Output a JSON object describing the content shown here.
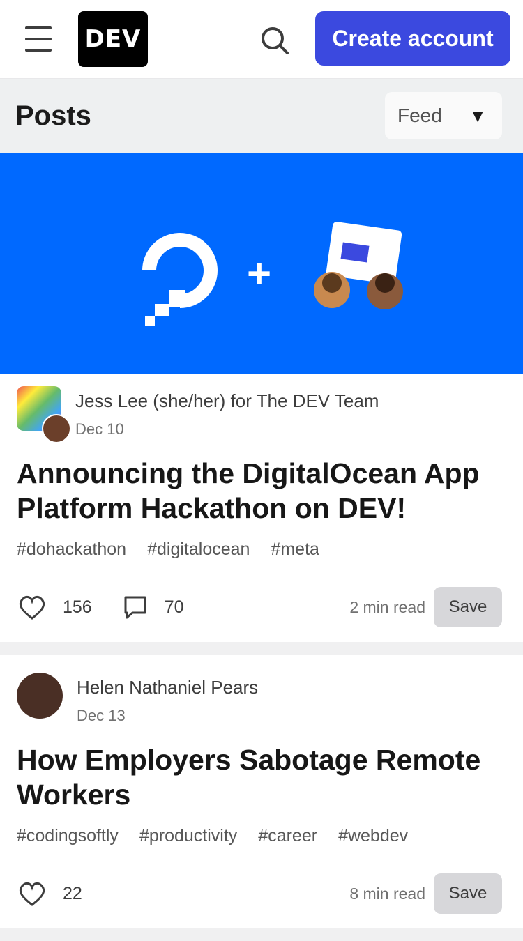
{
  "header": {
    "menu_icon": "hamburger-icon",
    "logo_text": "DEV",
    "search_icon": "search-icon",
    "create_account_label": "Create account"
  },
  "feed": {
    "title": "Posts",
    "sort_label": "Feed",
    "sort_icon": "chevron-down-icon"
  },
  "posts": [
    {
      "cover": {
        "brand_text": "DigitalOcean",
        "plus": "+",
        "background": "#0069ff"
      },
      "author": "Jess Lee (she/her) for The DEV Team",
      "date": "Dec 10",
      "title": "Announcing the DigitalOcean App Platform Hackathon on DEV!",
      "tags": [
        "#dohackathon",
        "#digitalocean",
        "#meta"
      ],
      "reactions": "156",
      "comments": "70",
      "read_time": "2 min read",
      "save_label": "Save"
    },
    {
      "author": "Helen Nathaniel Pears",
      "date": "Dec 13",
      "title": "How Employers Sabotage Remote Workers",
      "tags": [
        "#codingsoftly",
        "#productivity",
        "#career",
        "#webdev"
      ],
      "reactions": "22",
      "read_time": "8 min read",
      "save_label": "Save"
    }
  ],
  "colors": {
    "accent": "#3b49df",
    "background": "#f0f0f1"
  }
}
